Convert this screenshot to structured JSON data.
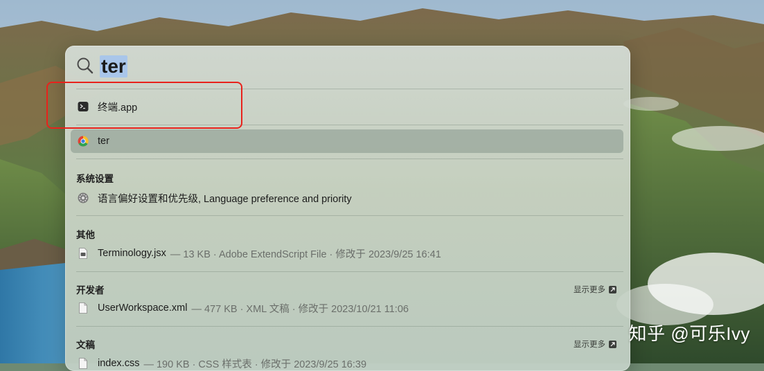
{
  "search": {
    "query": "ter"
  },
  "top_hits": [
    {
      "title": "终端.app",
      "icon": "terminal-icon"
    },
    {
      "title": "ter",
      "icon": "chrome-icon",
      "selected": true
    }
  ],
  "sections": [
    {
      "title": "系统设置",
      "items": [
        {
          "title": "语言偏好设置和优先级, Language preference and priority",
          "meta": "",
          "icon": "settings-gear-icon"
        }
      ]
    },
    {
      "title": "其他",
      "items": [
        {
          "title": "Terminology.jsx",
          "meta": "— 13 KB · Adobe ExtendScript File · 修改于 2023/9/25 16:41",
          "icon": "script-file-icon"
        }
      ]
    },
    {
      "title": "开发者",
      "show_more": "显示更多",
      "items": [
        {
          "title": "UserWorkspace.xml",
          "meta": "— 477 KB · XML 文稿 · 修改于 2023/10/21 11:06",
          "icon": "document-icon"
        }
      ]
    },
    {
      "title": "文稿",
      "show_more": "显示更多",
      "items": [
        {
          "title": "index.css",
          "meta": "— 190 KB · CSS 样式表 · 修改于 2023/9/25 16:39",
          "icon": "document-icon"
        }
      ]
    }
  ],
  "watermark": "知乎 @可乐Ivy",
  "colors": {
    "annotation_red": "#e8221c",
    "selection_highlight": "#a9c6ea"
  }
}
